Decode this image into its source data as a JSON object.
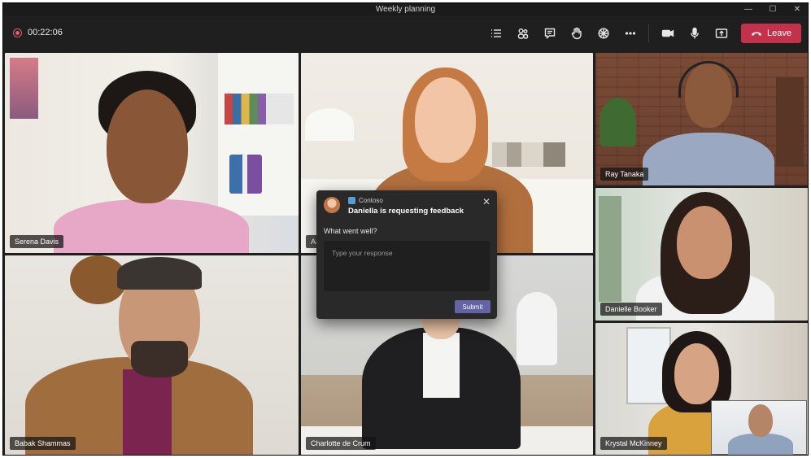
{
  "window": {
    "title": "Weekly planning",
    "controls": {
      "minimize": "—",
      "maximize": "☐",
      "close": "✕"
    }
  },
  "toolbar": {
    "recording_time": "00:22:06",
    "icons": [
      "list-icon",
      "participants-icon",
      "chat-icon",
      "raise-hand-icon",
      "apps-icon",
      "more-icon",
      "camera-icon",
      "mic-icon",
      "share-icon"
    ],
    "leave_label": "Leave",
    "leave_color": "#c4314b"
  },
  "participants": [
    {
      "name": "Serena Davis"
    },
    {
      "name": "Aa"
    },
    {
      "name": "Ray Tanaka"
    },
    {
      "name": "Danielle Booker"
    },
    {
      "name": "Babak Shammas"
    },
    {
      "name": "Charlotte de Crum"
    },
    {
      "name": "Krystal McKinney"
    }
  ],
  "popup": {
    "app_name": "Contoso",
    "title": "Daniella is requesting feedback",
    "question": "What went well?",
    "input_placeholder": "Type your response",
    "submit_label": "Submit",
    "accent_color": "#6264a7"
  }
}
